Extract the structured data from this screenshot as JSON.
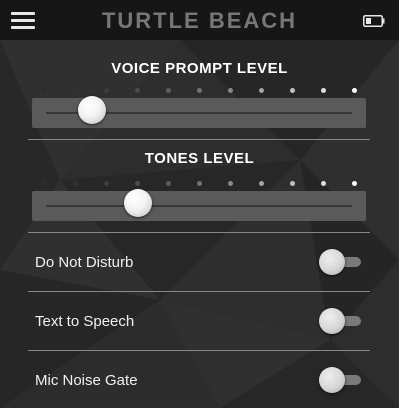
{
  "header": {
    "brand": "TURTLE BEACH",
    "menu_icon": "hamburger-menu-icon",
    "battery_icon": "battery-low-icon"
  },
  "colors": {
    "header_bg": "#161616",
    "background": "#2b2b2b",
    "text": "#ffffff",
    "brand": "#777777"
  },
  "sliders": [
    {
      "id": "voice-prompt",
      "title": "VOICE PROMPT LEVEL",
      "steps": 11,
      "level": 0.15
    },
    {
      "id": "tones",
      "title": "TONES LEVEL",
      "steps": 11,
      "level": 0.3
    }
  ],
  "toggles": [
    {
      "label": "Do Not Disturb",
      "on": false
    },
    {
      "label": "Text to Speech",
      "on": false
    },
    {
      "label": "Mic Noise Gate",
      "on": false
    }
  ]
}
